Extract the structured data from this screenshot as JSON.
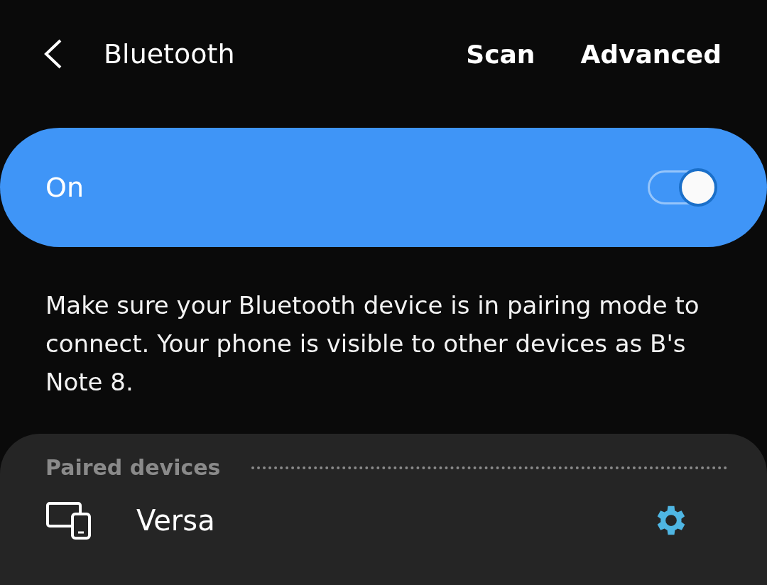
{
  "header": {
    "title": "Bluetooth",
    "actions": [
      "Scan",
      "Advanced"
    ]
  },
  "master_switch": {
    "label": "On",
    "on": true
  },
  "description": "Make sure your Bluetooth device is in pairing mode to connect. Your phone is visible to other devices as B's Note 8.",
  "paired_devices": {
    "heading": "Paired devices",
    "devices": [
      {
        "name": "Versa"
      }
    ]
  }
}
